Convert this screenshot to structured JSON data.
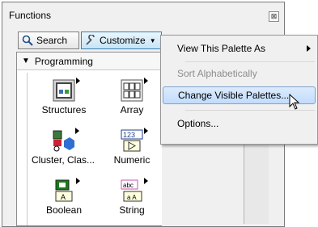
{
  "palette": {
    "title": "Functions",
    "close_glyph": "⊠",
    "search_label": "Search",
    "customize_label": "Customize",
    "category": "Programming",
    "items": [
      {
        "label": "Structures"
      },
      {
        "label": "Array"
      },
      {
        "label": "Cluster, Clas..."
      },
      {
        "label": "Numeric"
      },
      {
        "label": "Boolean"
      },
      {
        "label": "String"
      }
    ]
  },
  "menu": {
    "items": [
      {
        "label": "View This Palette As",
        "state": "enabled",
        "submenu": true
      },
      {
        "label": "Sort Alphabetically",
        "state": "disabled"
      },
      {
        "label": "Change Visible Palettes...",
        "state": "highlighted"
      },
      {
        "label": "Options...",
        "state": "enabled"
      }
    ]
  },
  "icons": {
    "search": "magnifier-icon",
    "customize": "wrench-icon",
    "cursor": "mouse-pointer-icon"
  },
  "colors": {
    "highlight": "#c1dcfc",
    "highlight_border": "#7da2ce",
    "disabled_text": "#8d8d8d"
  }
}
